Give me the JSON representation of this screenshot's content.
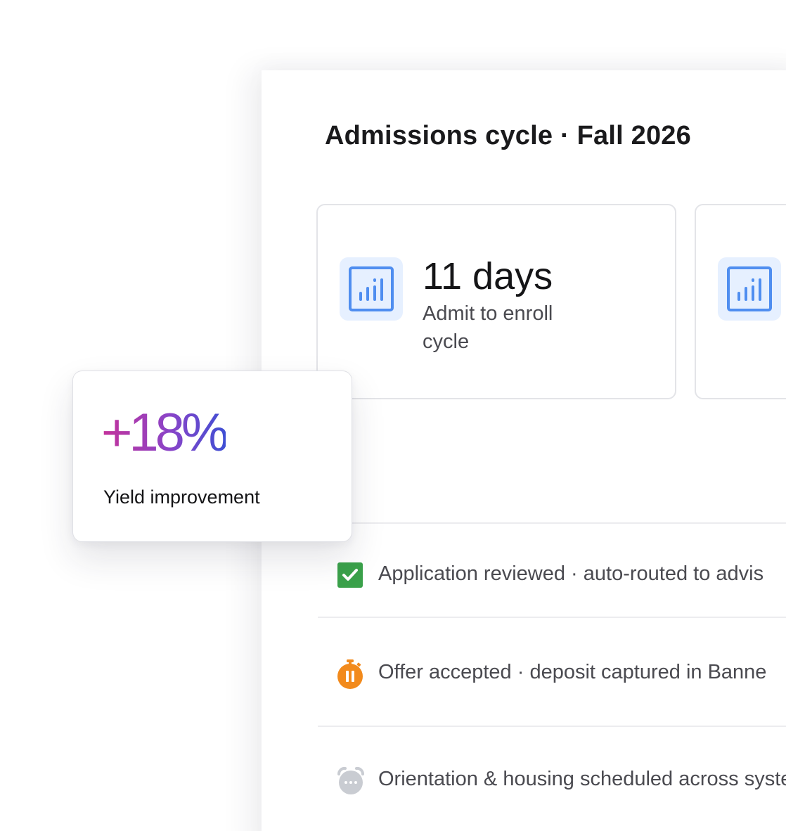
{
  "panel": {
    "title": "Admissions cycle · Fall 2026"
  },
  "stat_cards": [
    {
      "value": "11 days",
      "label": "Admit to enroll cycle",
      "icon": "bar-chart-icon"
    },
    {
      "value": "",
      "label": "",
      "icon": "bar-chart-icon"
    }
  ],
  "highlight": {
    "value": "+18%",
    "label": "Yield improvement",
    "gradient_colors": [
      "#c4329a",
      "#8a44c8",
      "#3f4fd4"
    ]
  },
  "feed": [
    {
      "text": "Application reviewed · auto-routed to advis",
      "icon": "checkbox-checked-icon",
      "status_color": "#3aa14a"
    },
    {
      "text": "Offer accepted · deposit captured in Banne",
      "icon": "timer-paused-icon",
      "status_color": "#f28a1c"
    },
    {
      "text": "Orientation & housing scheduled across systen",
      "icon": "alarm-clock-icon",
      "status_color": "#c9ccd2"
    }
  ],
  "colors": {
    "icon_tile_bg": "#e6f0ff",
    "icon_stroke": "#4f8ef0",
    "card_border": "#e3e4e8",
    "text_primary": "#1a1a1c",
    "text_secondary": "#4a4a50"
  }
}
